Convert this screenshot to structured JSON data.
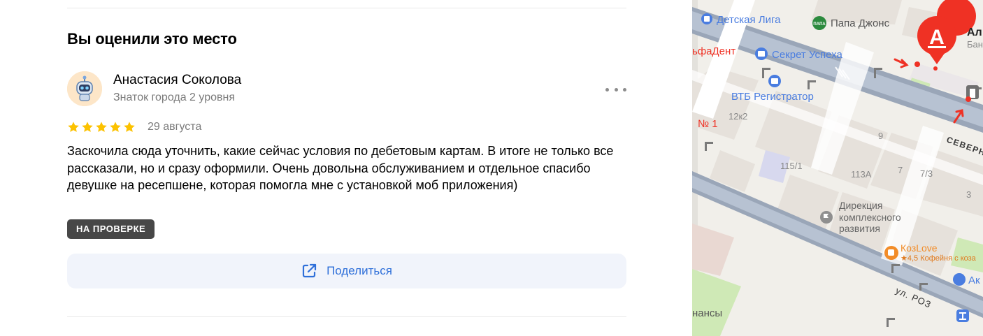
{
  "review_section": {
    "title": "Вы оценили это место",
    "author": {
      "name": "Анастасия Соколова",
      "level": "Знаток города 2 уровня",
      "avatar_icon": "robot-avatar-icon"
    },
    "rating": 5,
    "rating_max": 5,
    "date": "29 августа",
    "text": "Заскочила сюда уточнить, какие сейчас условия по дебетовым картам. В итоге не только все рассказали, но и сразу оформили. Очень довольна обслуживанием и отдельное спасибо девушке на ресепшене, которая помогла мне с установкой моб приложения)",
    "status_badge": "НА ПРОВЕРКЕ",
    "share_label": "Поделиться",
    "menu_icon": "more-dots-icon",
    "colors": {
      "star": "#fcc200",
      "badge_bg": "#474747",
      "share_bg": "#f1f4fb",
      "link": "#2e6fd9"
    }
  },
  "map": {
    "labels": {
      "detskaya_liga": "Детская Лига",
      "papa_johns": "Папа Джонс",
      "papa_logo": "ПАПА",
      "alfadent": "ьфаДент",
      "sekret_uspekha": "Секрет Успеха",
      "vtb_registrator": "ВТБ Регистратор",
      "no1": "№ 1",
      "b12k2": "12к2",
      "b9": "9",
      "severn": "СЕВЕРН",
      "b115_1": "115/1",
      "b113a": "113А",
      "b7": "7",
      "b7_3": "7/3",
      "b3": "3",
      "direkciya_1": "Дирекция",
      "direkciya_2": "комплексного",
      "direkciya_3": "развития",
      "kozlove": "КозLove",
      "kozlove_sub": "★4,5 Кофейня с коза",
      "street_roz": "ул. РОЗ",
      "finansy": "нансы",
      "alfa_short": "Ал",
      "alfa_sub": "Бан",
      "ak_short": "Ак",
      "alfa_logo": "А"
    },
    "colors": {
      "alfa_red": "#ef3124",
      "poi_blue": "#4a7de0",
      "poi_gray": "#8f8f8f",
      "kozlove_orange": "#f28c28"
    }
  }
}
